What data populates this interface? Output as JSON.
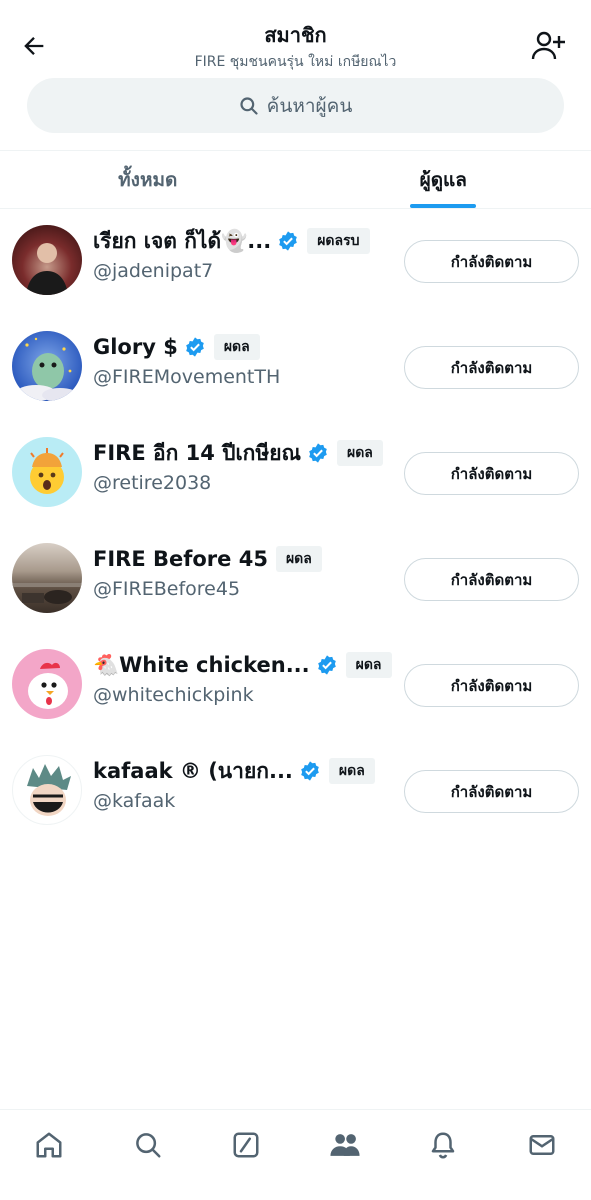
{
  "header": {
    "title": "สมาชิก",
    "subtitle": "FIRE ชุมชนคนรุ่น ใหม่ เกษียณไว"
  },
  "search": {
    "placeholder": "ค้นหาผู้คน",
    "icon": "search-icon"
  },
  "tabs": [
    {
      "label": "ทั้งหมด",
      "active": false
    },
    {
      "label": "ผู้ดูแล",
      "active": true
    }
  ],
  "members": [
    {
      "name": "เรียก เจต ก็ได้👻...",
      "handle": "@jadenipat7",
      "verified": true,
      "badge": "ผดลรบ",
      "button": "กำลังติดตาม",
      "avatar_color": "#5a2a2a"
    },
    {
      "name": "Glory $",
      "handle": "@FIREMovementTH",
      "verified": true,
      "badge": "ผดล",
      "button": "กำลังติดตาม",
      "avatar_color": "#3f6fd1"
    },
    {
      "name": "FIRE อีก 14 ปีเกษียณ",
      "handle": "@retire2038",
      "verified": true,
      "badge": "ผดล",
      "button": "กำลังติดตาม",
      "avatar_color": "#b9ecf5"
    },
    {
      "name": "FIRE Before 45",
      "handle": "@FIREBefore45",
      "verified": false,
      "badge": "ผดล",
      "button": "กำลังติดตาม",
      "avatar_color": "#7a6a5a"
    },
    {
      "name": "🐔White chicken...",
      "handle": "@whitechickpink",
      "verified": true,
      "badge": "ผดล",
      "button": "กำลังติดตาม",
      "avatar_color": "#f3a6c8"
    },
    {
      "name": "kafaak ® (นายก...",
      "handle": "@kafaak",
      "verified": true,
      "badge": "ผดล",
      "button": "กำลังติดตาม",
      "avatar_color": "#ffffff"
    }
  ],
  "bottom_nav": [
    "home-icon",
    "search-icon",
    "compose-icon",
    "communities-icon",
    "notifications-icon",
    "messages-icon"
  ],
  "colors": {
    "accent": "#1d9bf0",
    "text_primary": "#0f1419",
    "text_secondary": "#536471",
    "badge_bg": "#eff3f4"
  }
}
